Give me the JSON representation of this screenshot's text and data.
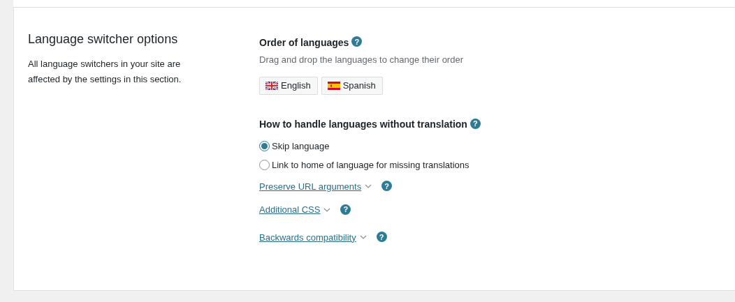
{
  "section": {
    "title": "Language switcher options",
    "description": "All language switchers in your site are affected by the settings in this section."
  },
  "order": {
    "heading": "Order of languages",
    "help": "?",
    "hint": "Drag and drop the languages to change their order",
    "languages": [
      {
        "label": "English",
        "kind": "uk"
      },
      {
        "label": "Spanish",
        "kind": "es"
      }
    ]
  },
  "missing": {
    "heading": "How to handle languages without translation",
    "help": "?",
    "options": [
      {
        "label": "Skip language",
        "selected": true
      },
      {
        "label": "Link to home of language for missing translations",
        "selected": false
      }
    ]
  },
  "toggles": [
    {
      "label": "Preserve URL arguments",
      "help": "?"
    },
    {
      "label": "Additional CSS",
      "help": "?"
    },
    {
      "label": "Backwards compatibility",
      "help": "?"
    }
  ]
}
